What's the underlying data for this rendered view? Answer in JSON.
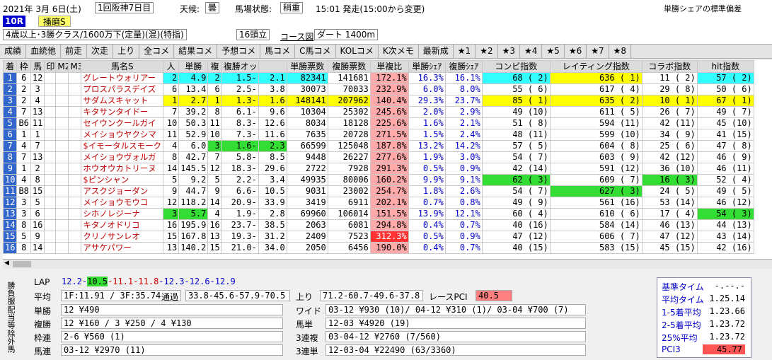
{
  "header": {
    "date": "2021年 3月 6日(土)",
    "meeting": "1回阪神7日目",
    "weather_label": "天候:",
    "weather": "曇",
    "track_label": "馬場状態:",
    "track": "稍重",
    "start": "15:01 発走(15:00から変更)",
    "title_right": "単勝シェアの標準偏差",
    "race_no": "10R",
    "race_name": "播磨S",
    "cond": "4歳以上･3勝クラス/1600万下(定量)(混)(特指)",
    "heads": "16頭立",
    "course_label": "コース図",
    "course": "ダート 1400m"
  },
  "tabs": [
    "成績",
    "血統他",
    "前走",
    "次走",
    "上り",
    "全コメ",
    "結果コメ",
    "予想コメ",
    "馬コメ",
    "C馬コメ",
    "KOLコメ",
    "K次メモ",
    "最新成",
    "★1",
    "★2",
    "★3",
    "★4",
    "★5",
    "★6",
    "★7",
    "★8"
  ],
  "columns": [
    "着",
    "枠",
    "馬",
    "印",
    "M2",
    "M3",
    "馬名S",
    "人",
    "単勝",
    "複",
    "複勝オッズ",
    "",
    "単勝票数",
    "複勝票数",
    "単複比",
    "単勝ｼｪｱ",
    "複勝ｼｪｱ",
    "コンビ指数",
    "レイティング指数",
    "コラボ指数",
    "hit指数"
  ],
  "rows": [
    [
      "1",
      "6",
      "12",
      "",
      "",
      "",
      "グレートウォリアー",
      "2",
      "4.9",
      "2",
      "1.5-",
      "2.1",
      "82341",
      "141681",
      "172.1%",
      "16.3%",
      "16.1%",
      "68 ( 2)",
      "636 ( 1)",
      "11 ( 2)",
      "57 ( 2)"
    ],
    [
      "2",
      "2",
      "3",
      "",
      "",
      "",
      "プロスパラスデイズ",
      "6",
      "13.4",
      "6",
      "2.5-",
      "3.8",
      "30073",
      "70033",
      "232.9%",
      "6.0%",
      "8.0%",
      "55 ( 6)",
      "617 ( 4)",
      "29 ( 8)",
      "50 ( 6)"
    ],
    [
      "3",
      "2",
      "4",
      "",
      "",
      "",
      "サダムスキャット",
      "1",
      "2.7",
      "1",
      "1.3-",
      "1.6",
      "148141",
      "207962",
      "140.4%",
      "29.3%",
      "23.7%",
      "85 ( 1)",
      "635 ( 2)",
      "10 ( 1)",
      "67 ( 1)"
    ],
    [
      "4",
      "7",
      "13",
      "",
      "",
      "",
      "キタサンタイドー",
      "7",
      "39.2",
      "8",
      "6.1-",
      "9.6",
      "10304",
      "25302",
      "245.6%",
      "2.0%",
      "2.9%",
      "49 (10)",
      "611 ( 5)",
      "26 ( 7)",
      "49 ( 7)"
    ],
    [
      "5",
      "B6",
      "11",
      "",
      "",
      "",
      "セイウンクールガイ",
      "10",
      "50.3",
      "11",
      "8.3-",
      "12.6",
      "8034",
      "18128",
      "225.6%",
      "1.6%",
      "2.1%",
      "51 ( 8)",
      "594 (11)",
      "42 (11)",
      "45 (10)"
    ],
    [
      "6",
      "1",
      "1",
      "",
      "",
      "",
      "メイショウヤクシマ",
      "11",
      "52.9",
      "10",
      "7.3-",
      "11.6",
      "7635",
      "20728",
      "271.5%",
      "1.5%",
      "2.4%",
      "48 (11)",
      "599 (10)",
      "34 ( 9)",
      "41 (15)"
    ],
    [
      "7",
      "4",
      "7",
      "",
      "",
      "",
      "$イモータルスモーク",
      "4",
      "6.0",
      "3",
      "1.6-",
      "2.3",
      "66599",
      "125048",
      "187.8%",
      "13.2%",
      "14.2%",
      "57 ( 5)",
      "604 ( 8)",
      "25 ( 6)",
      "47 ( 8)"
    ],
    [
      "8",
      "7",
      "13",
      "",
      "",
      "",
      "メイショウヴォルガ",
      "8",
      "42.7",
      "7",
      "5.8-",
      "8.5",
      "9448",
      "26227",
      "277.6%",
      "1.9%",
      "3.0%",
      "54 ( 7)",
      "603 ( 9)",
      "42 (12)",
      "46 ( 9)"
    ],
    [
      "9",
      "1",
      "2",
      "",
      "",
      "",
      "ホウオウカトリーヌ",
      "14",
      "145.5",
      "12",
      "18.3-",
      "29.6",
      "2722",
      "7928",
      "291.3%",
      "0.5%",
      "0.9%",
      "42 (14)",
      "591 (12)",
      "36 (10)",
      "46 (11)"
    ],
    [
      "10",
      "4",
      "8",
      "",
      "",
      "",
      "$ピンシャン",
      "5",
      "9.2",
      "5",
      "2.2-",
      "3.4",
      "49935",
      "80006",
      "160.2%",
      "9.9%",
      "9.1%",
      "62 ( 3)",
      "609 ( 7)",
      "16 ( 3)",
      "52 ( 4)"
    ],
    [
      "11",
      "B8",
      "15",
      "",
      "",
      "",
      "アスクジョーダン",
      "9",
      "44.7",
      "9",
      "6.6-",
      "10.5",
      "9031",
      "23002",
      "254.7%",
      "1.8%",
      "2.6%",
      "54 ( 7)",
      "627 ( 3)",
      "24 ( 5)",
      "49 ( 5)"
    ],
    [
      "12",
      "3",
      "5",
      "",
      "",
      "",
      "メイショウモウコ",
      "12",
      "118.2",
      "14",
      "20.9-",
      "33.9",
      "3419",
      "6911",
      "202.1%",
      "0.7%",
      "0.8%",
      "49 ( 9)",
      "561 (16)",
      "53 (14)",
      "46 (12)"
    ],
    [
      "13",
      "3",
      "6",
      "",
      "",
      "",
      "シホノレジーナ",
      "3",
      "5.7",
      "4",
      "1.9-",
      "2.8",
      "69960",
      "106014",
      "151.5%",
      "13.9%",
      "12.1%",
      "60 ( 4)",
      "610 ( 6)",
      "17 ( 4)",
      "54 ( 3)"
    ],
    [
      "14",
      "8",
      "16",
      "",
      "",
      "",
      "キタノオドリコ",
      "16",
      "195.9",
      "16",
      "23.7-",
      "38.5",
      "2063",
      "6081",
      "294.8%",
      "0.4%",
      "0.7%",
      "40 (16)",
      "584 (14)",
      "46 (13)",
      "44 (13)"
    ],
    [
      "15",
      "5",
      "9",
      "",
      "",
      "",
      "クリノサンレオ",
      "15",
      "167.8",
      "13",
      "19.3-",
      "31.2",
      "2409",
      "7523",
      "312.3%",
      "0.5%",
      "0.9%",
      "47 (12)",
      "606 ( 7)",
      "47 (12)",
      "43 (14)"
    ],
    [
      "16",
      "8",
      "14",
      "",
      "",
      "",
      "アサケパワー",
      "13",
      "140.2",
      "15",
      "21.0-",
      "34.0",
      "2050",
      "6456",
      "190.0%",
      "0.4%",
      "0.7%",
      "40 (15)",
      "583 (15)",
      "45 (15)",
      "42 (16)"
    ]
  ],
  "highlights": {
    "cyan": "#33ffff",
    "yellow": "#ffff00",
    "green": "#33dd33",
    "red": "#ff3333",
    "pink": "#ffaaaa",
    "blue_bg": "#3366cc"
  },
  "bottom": {
    "lap_label": "LAP",
    "lap": [
      "12.2-",
      "10.5",
      "-11.1-",
      "11.8",
      "-12.3-12.6-12.9"
    ],
    "avg_label": "平均",
    "avg": "1F:11.91 / 3F:35.74",
    "pass_label": "通過",
    "pass": "33.8-45.6-57.9-70.5",
    "up_label": "上り",
    "up": "71.2-60.7-49.6-37.8",
    "pci_label": "レースPCI",
    "pci": "40.5",
    "tan_label": "単勝",
    "tan": "12 ¥490",
    "wide_label": "ワイド",
    "wide": "03-12 ¥930 (10)/ 04-12 ¥310 (1)/ 03-04 ¥700 (7)",
    "fuku_label": "複勝",
    "fuku": "12 ¥160 / 3 ¥250 / 4 ¥130",
    "umatan_label": "馬単",
    "umatan": "12-03 ¥4920 (19)",
    "waku_label": "枠連",
    "waku": "2-6 ¥560 (1)",
    "renpuku_label": "3連複",
    "renpuku": "03-04-12 ¥2760 (7/560)",
    "umaren_label": "馬連",
    "umaren": "03-12 ¥2970 (11)",
    "rentan_label": "3連単",
    "rentan": "12-03-04 ¥22490 (63/3360)",
    "side1": "勝負服",
    "side2": "配当等",
    "side3": "除外馬"
  },
  "stats": [
    {
      "label": "基準タイム",
      "value": "-.--.-"
    },
    {
      "label": "平均タイム",
      "value": "1.25.14"
    },
    {
      "label": "1-5着平均",
      "value": "1.23.66"
    },
    {
      "label": "2-5着平均",
      "value": "1.23.72"
    },
    {
      "label": "25%平均",
      "value": "1.23.72"
    },
    {
      "label": "PCI3",
      "value": "45.77"
    }
  ]
}
